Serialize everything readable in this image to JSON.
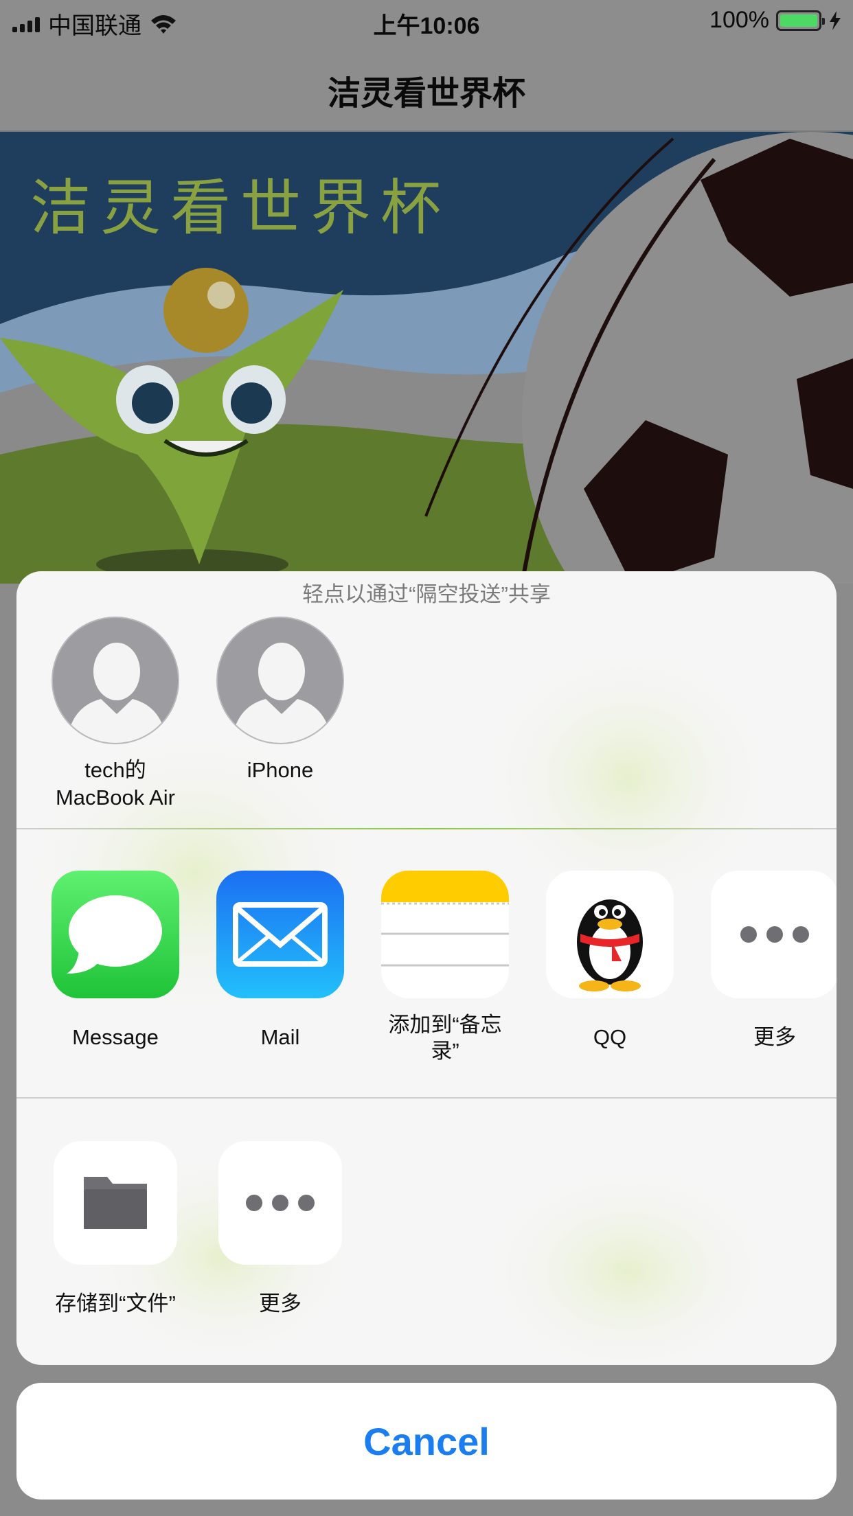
{
  "status_bar": {
    "carrier": "中国联通",
    "time": "上午10:06",
    "battery": "100%"
  },
  "navbar": {
    "title": "洁灵看世界杯"
  },
  "banner": {
    "title": "洁灵看世界杯"
  },
  "share_sheet": {
    "airdrop_hint": "轻点以通过“隔空投送”共享",
    "airdrop_targets": [
      {
        "line1": "tech的",
        "line2": "MacBook Air"
      },
      {
        "line1": "iPhone",
        "line2": ""
      }
    ],
    "apps": [
      {
        "label": "Message",
        "icon": "messages-icon"
      },
      {
        "label": "Mail",
        "icon": "mail-icon"
      },
      {
        "label_line1": "添加到“备忘",
        "label_line2": "录”",
        "icon": "notes-icon"
      },
      {
        "label": "QQ",
        "icon": "qq-penguin-icon"
      },
      {
        "label": "更多",
        "icon": "more-dots-icon"
      }
    ],
    "actions": [
      {
        "label": "存储到“文件”",
        "icon": "folder-icon"
      },
      {
        "label": "更多",
        "icon": "more-dots-icon"
      }
    ]
  },
  "cancel": {
    "label": "Cancel"
  },
  "colors": {
    "accent": "#1a7ef0",
    "messages_green": "#34c759",
    "mail_blue": "#1f8bf5",
    "notes_yellow": "#ffcc00",
    "qq_red": "#e8262a"
  }
}
